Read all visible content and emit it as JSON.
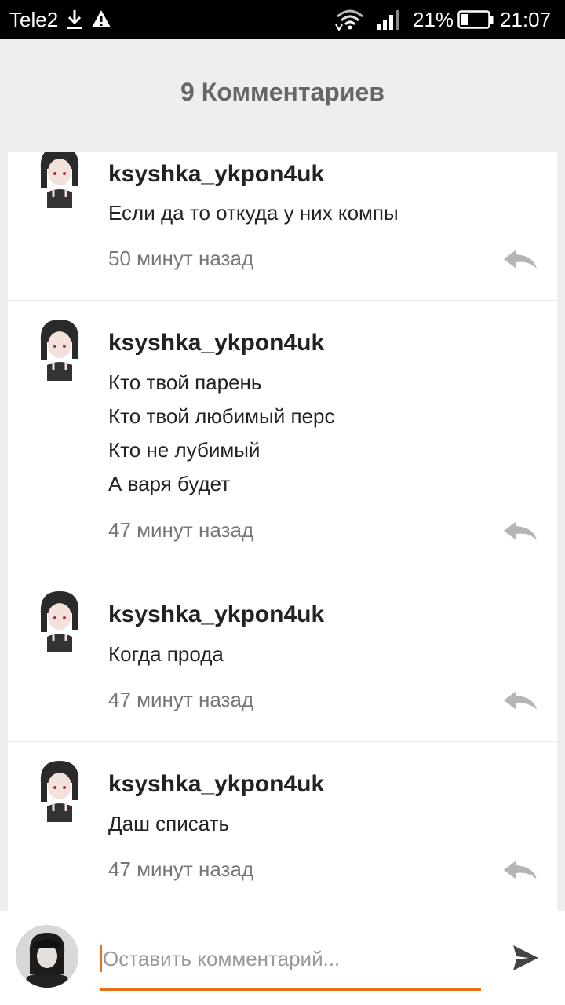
{
  "status_bar": {
    "carrier": "Tele2",
    "battery_percent": "21%",
    "time": "21:07"
  },
  "header": {
    "title": "9 Комментариев"
  },
  "comments": [
    {
      "author": "ksyshka_ykpon4uk",
      "lines": [
        "Если да то откуда у них компы"
      ],
      "time": "50 минут назад"
    },
    {
      "author": "ksyshka_ykpon4uk",
      "lines": [
        "Кто твой парень",
        "Кто твой любимый перс",
        "Кто не лубимый",
        "А варя будет"
      ],
      "time": "47 минут назад"
    },
    {
      "author": "ksyshka_ykpon4uk",
      "lines": [
        "Когда прода"
      ],
      "time": "47 минут назад"
    },
    {
      "author": "ksyshka_ykpon4uk",
      "lines": [
        "Даш списать"
      ],
      "time": "47 минут назад"
    }
  ],
  "composer": {
    "placeholder": "Оставить комментарий..."
  },
  "colors": {
    "accent": "#e8701a",
    "title_gray": "#666666",
    "meta_gray": "#777777"
  },
  "icons": {
    "reply": "reply-arrow-icon",
    "send": "send-icon",
    "download": "download-icon",
    "warning": "warning-icon",
    "wifi": "wifi-icon",
    "signal": "signal-icon",
    "battery": "battery-icon"
  }
}
